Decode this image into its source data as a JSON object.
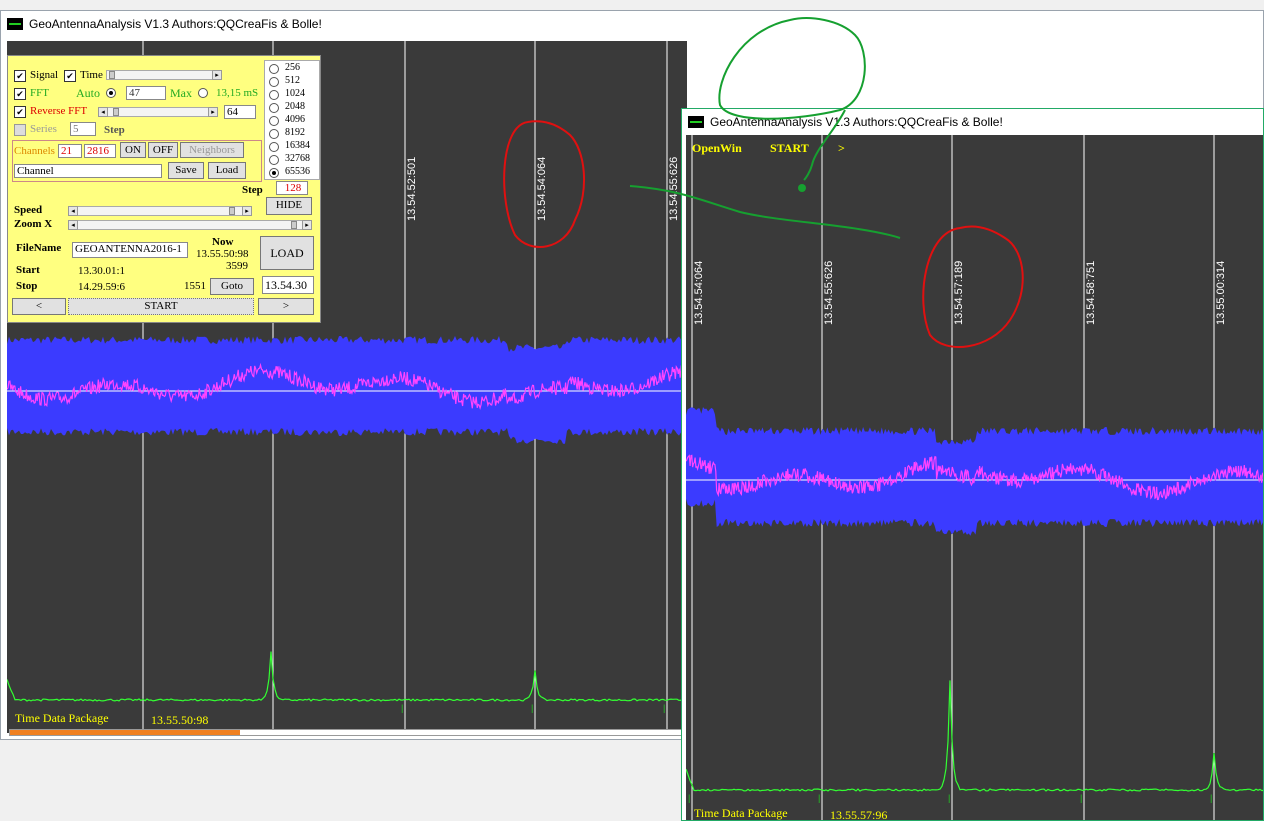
{
  "main_window": {
    "title": "GeoAntennaAnalysis V1.3 Authors:QQCreaFis & Bolle!",
    "time_markers": [
      "13.54.52:501",
      "13.54.54:064",
      "13.54.55:626"
    ],
    "footer_label": "Time Data Package",
    "footer_time": "13.55.50:98"
  },
  "control_panel": {
    "signal_label": "Signal",
    "signal_checked": "✔",
    "time_label": "Time",
    "time_checked": "✔",
    "fft_label": "FFT",
    "fft_checked": "✔",
    "auto_label": "Auto",
    "auto_value": "47",
    "max_label": "Max",
    "max_value": "13,15 mS",
    "reverse_fft_label": "Reverse FFT",
    "reverse_fft_checked": "✔",
    "reverse_fft_value": "64",
    "series_label": "Series",
    "series_value": "5",
    "series_step_label": "Step",
    "channels_label": "Channels",
    "channels_from": "21",
    "channels_to": "2816",
    "on_button": "ON",
    "off_button": "OFF",
    "neighbors_button": "Neighbors",
    "channel_name_value": "Channel",
    "save_button": "Save",
    "load_small_button": "Load",
    "fft_sizes": [
      "256",
      "512",
      "1024",
      "2048",
      "4096",
      "8192",
      "16384",
      "32768",
      "65536"
    ],
    "fft_size_selected": "65536",
    "step_label": "Step",
    "step_value": "128",
    "hide_button": "HIDE",
    "speed_label": "Speed",
    "zoom_label": "Zoom X",
    "filename_label": "FileName",
    "filename_value": "GEOANTENNA2016-1",
    "now_label": "Now",
    "now_value": "13.55.50:98",
    "now_count": "3599",
    "load_button": "LOAD",
    "start_label": "Start",
    "start_value": "13.30.01:1",
    "stop_label": "Stop",
    "stop_value": "14.29.59:6",
    "goto_count": "1551",
    "goto_button": "Goto",
    "goto_value": "13.54.30",
    "prev_button": "<",
    "start_button": "START",
    "next_button": ">"
  },
  "second_window": {
    "title": "GeoAntennaAnalysis V1.3 Authors:QQCreaFis & Bolle!",
    "openwin_label": "OpenWin",
    "start_label": "START",
    "next_label": ">",
    "time_markers": [
      "13.54.54:064",
      "13.54.55:626",
      "13.54.57:189",
      "13.54.58:751",
      "13.55.00:314"
    ],
    "footer_label": "Time Data Package",
    "footer_time": "13.55.57:96"
  },
  "colors": {
    "plot_bg": "#3a3a3a",
    "signal_band": "#3b3bff",
    "signal_trace": "#ff44ff",
    "fft_trace": "#33ff33",
    "annotation_red": "#e01010",
    "annotation_green": "#16a030",
    "panel_bg": "#ffff80",
    "footer_text": "#ffff00"
  }
}
